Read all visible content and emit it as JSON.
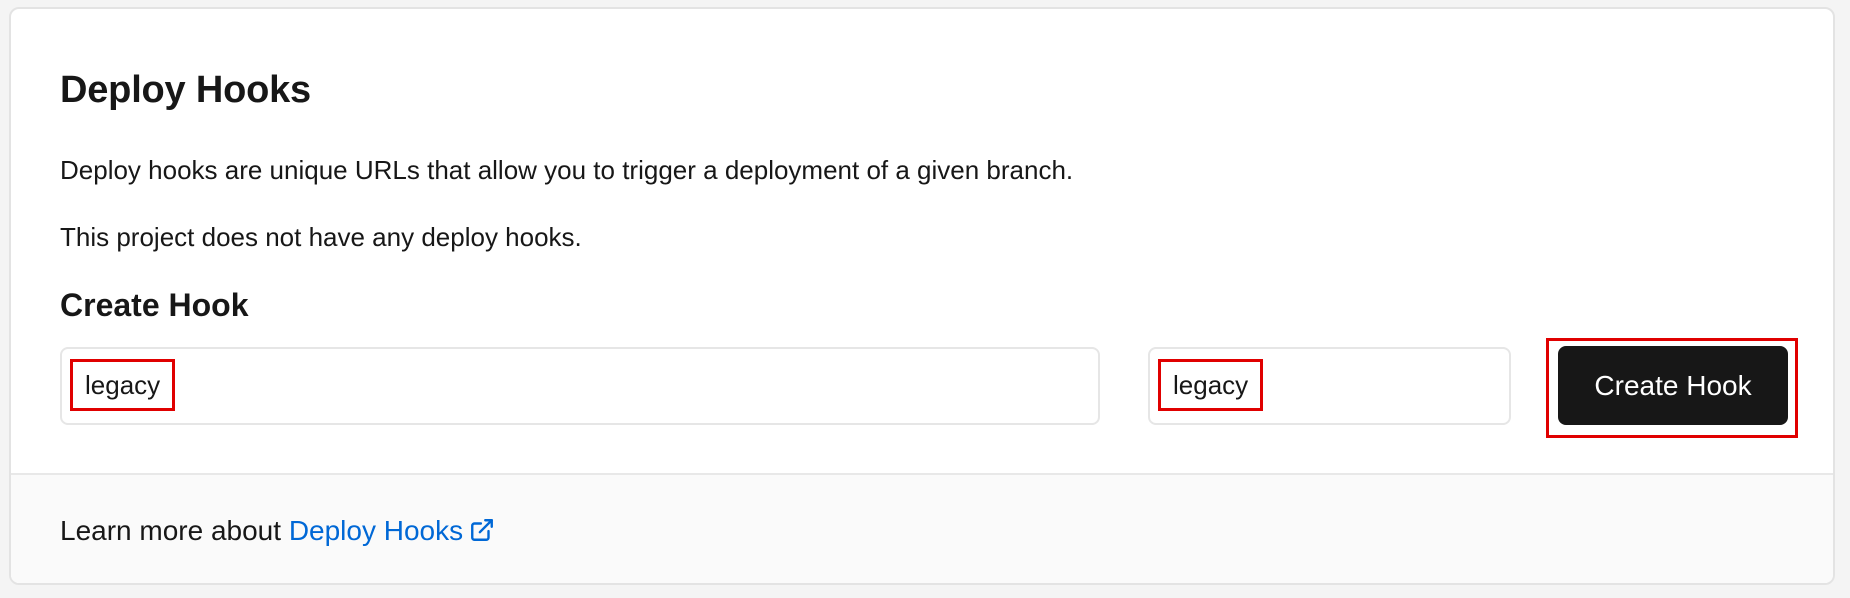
{
  "section": {
    "title": "Deploy Hooks",
    "description": "Deploy hooks are unique URLs that allow you to trigger a deployment of a given branch.",
    "empty_state": "This project does not have any deploy hooks."
  },
  "create_hook": {
    "title": "Create Hook",
    "name_input": {
      "value": "legacy"
    },
    "branch_input": {
      "value": "legacy"
    },
    "submit_label": "Create Hook"
  },
  "footer": {
    "prefix": "Learn more about ",
    "link_label": "Deploy Hooks",
    "link_icon": "external-link-icon"
  },
  "colors": {
    "button_bg": "#171717",
    "link": "#0068d6",
    "highlight": "#e00000"
  }
}
